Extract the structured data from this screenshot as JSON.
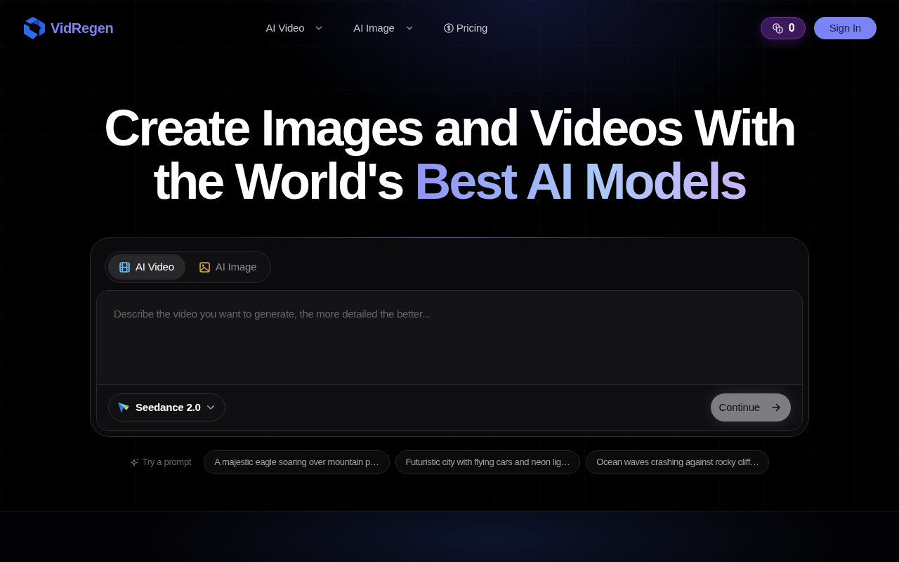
{
  "header": {
    "logo": "VidRegen",
    "nav": [
      {
        "label": "AI Video",
        "kind": "dropdown"
      },
      {
        "label": "AI Image",
        "kind": "dropdown"
      },
      {
        "label": "Pricing",
        "kind": "link"
      }
    ],
    "credits": "0",
    "sign_in": "Sign In"
  },
  "hero": {
    "title_line_1": "Create Images and Videos With",
    "title_line_2": "the World's **Best AI Models**"
  },
  "generator": {
    "tabs": [
      {
        "label": "AI Video",
        "kind": "video",
        "selected": true
      },
      {
        "label": "AI Image",
        "kind": "image",
        "selected": false
      }
    ],
    "prompt": {
      "placeholder": "Describe the video you want to generate, the more detailed the better..."
    },
    "model": "Seedance 2.0",
    "submit": "Continue"
  },
  "try_prompt": {
    "label": "Try a prompt",
    "suggestions": [
      "A majestic eagle soaring over mountain p…",
      "Futuristic city with flying cars and neon lig…",
      "Ocean waves crashing against rocky cliff…"
    ]
  }
}
